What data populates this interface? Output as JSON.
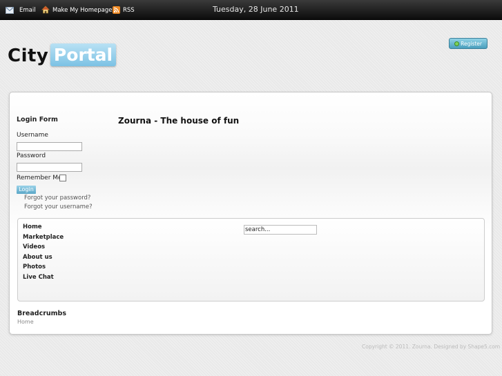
{
  "topbar": {
    "email_label": "Email",
    "homepage_label": "Make My Homepage",
    "rss_label": "RSS",
    "date": "Tuesday, 28 June 2011"
  },
  "logo": {
    "part1": "City",
    "part2": "Portal"
  },
  "header": {
    "register_label": "Register"
  },
  "login": {
    "title": "Login Form",
    "username_label": "Username",
    "username_value": "",
    "password_label": "Password",
    "password_value": "",
    "remember_label": "Remember Me",
    "login_button": "Login",
    "forgot_password": "Forgot your password?",
    "forgot_username": "Forgot your username?"
  },
  "main": {
    "title": "Zourna - The house of fun"
  },
  "nav": {
    "items": [
      "Home",
      "Marketplace",
      "Videos",
      "About us",
      "Photos",
      "Live Chat"
    ]
  },
  "search": {
    "value": "search..."
  },
  "breadcrumbs": {
    "title": "Breadcrumbs",
    "current": "Home"
  },
  "footer": {
    "text": "Copyright © 2011. Zourna. Designed by Shape5.com"
  },
  "colors": {
    "topbar": "#1a1a1a",
    "logo_accent": "#7cc2e4",
    "register": "#4a9fbd"
  },
  "icons": {
    "email": "mail-icon",
    "homepage": "home-icon",
    "rss": "rss-icon",
    "register": "plus-icon"
  }
}
